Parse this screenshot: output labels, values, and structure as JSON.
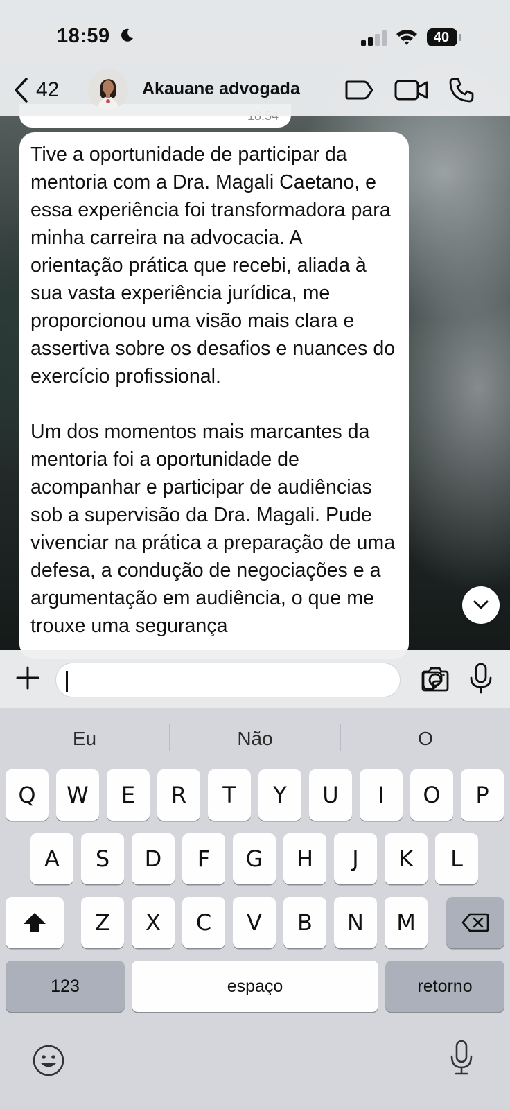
{
  "status_bar": {
    "time": "18:59",
    "battery": "40"
  },
  "header": {
    "back_count": "42",
    "contact_name": "Akauane advogada"
  },
  "chat": {
    "previous_time_partial": "18:54",
    "message_paragraphs": [
      "Tive a oportunidade de participar da mentoria com a Dra. Magali Caetano, e essa experiência foi transformadora para minha carreira na advocacia. A orientação prática que recebi, aliada à sua vasta experiência jurídica, me proporcionou uma visão mais clara e assertiva sobre os desafios e nuances do exercício profissional.",
      "Um dos momentos mais marcantes da mentoria foi a oportunidade de acompanhar e participar de audiências sob a supervisão da Dra. Magali. Pude vivenciar na prática a preparação de uma defesa, a condução de negociações e a argumentação em audiência, o que me trouxe uma segurança"
    ]
  },
  "composer": {
    "value": ""
  },
  "keyboard": {
    "suggestions": [
      "Eu",
      "Não",
      "O"
    ],
    "row1": [
      "Q",
      "W",
      "E",
      "R",
      "T",
      "Y",
      "U",
      "I",
      "O",
      "P"
    ],
    "row2": [
      "A",
      "S",
      "D",
      "F",
      "G",
      "H",
      "J",
      "K",
      "L"
    ],
    "row3": [
      "Z",
      "X",
      "C",
      "V",
      "B",
      "N",
      "M"
    ],
    "numbers_label": "123",
    "space_label": "espaço",
    "return_label": "retorno"
  },
  "colors": {
    "bubble": "#ffffff",
    "keyboard_bg": "#d4d6db",
    "dark_key": "#abb0ba"
  }
}
